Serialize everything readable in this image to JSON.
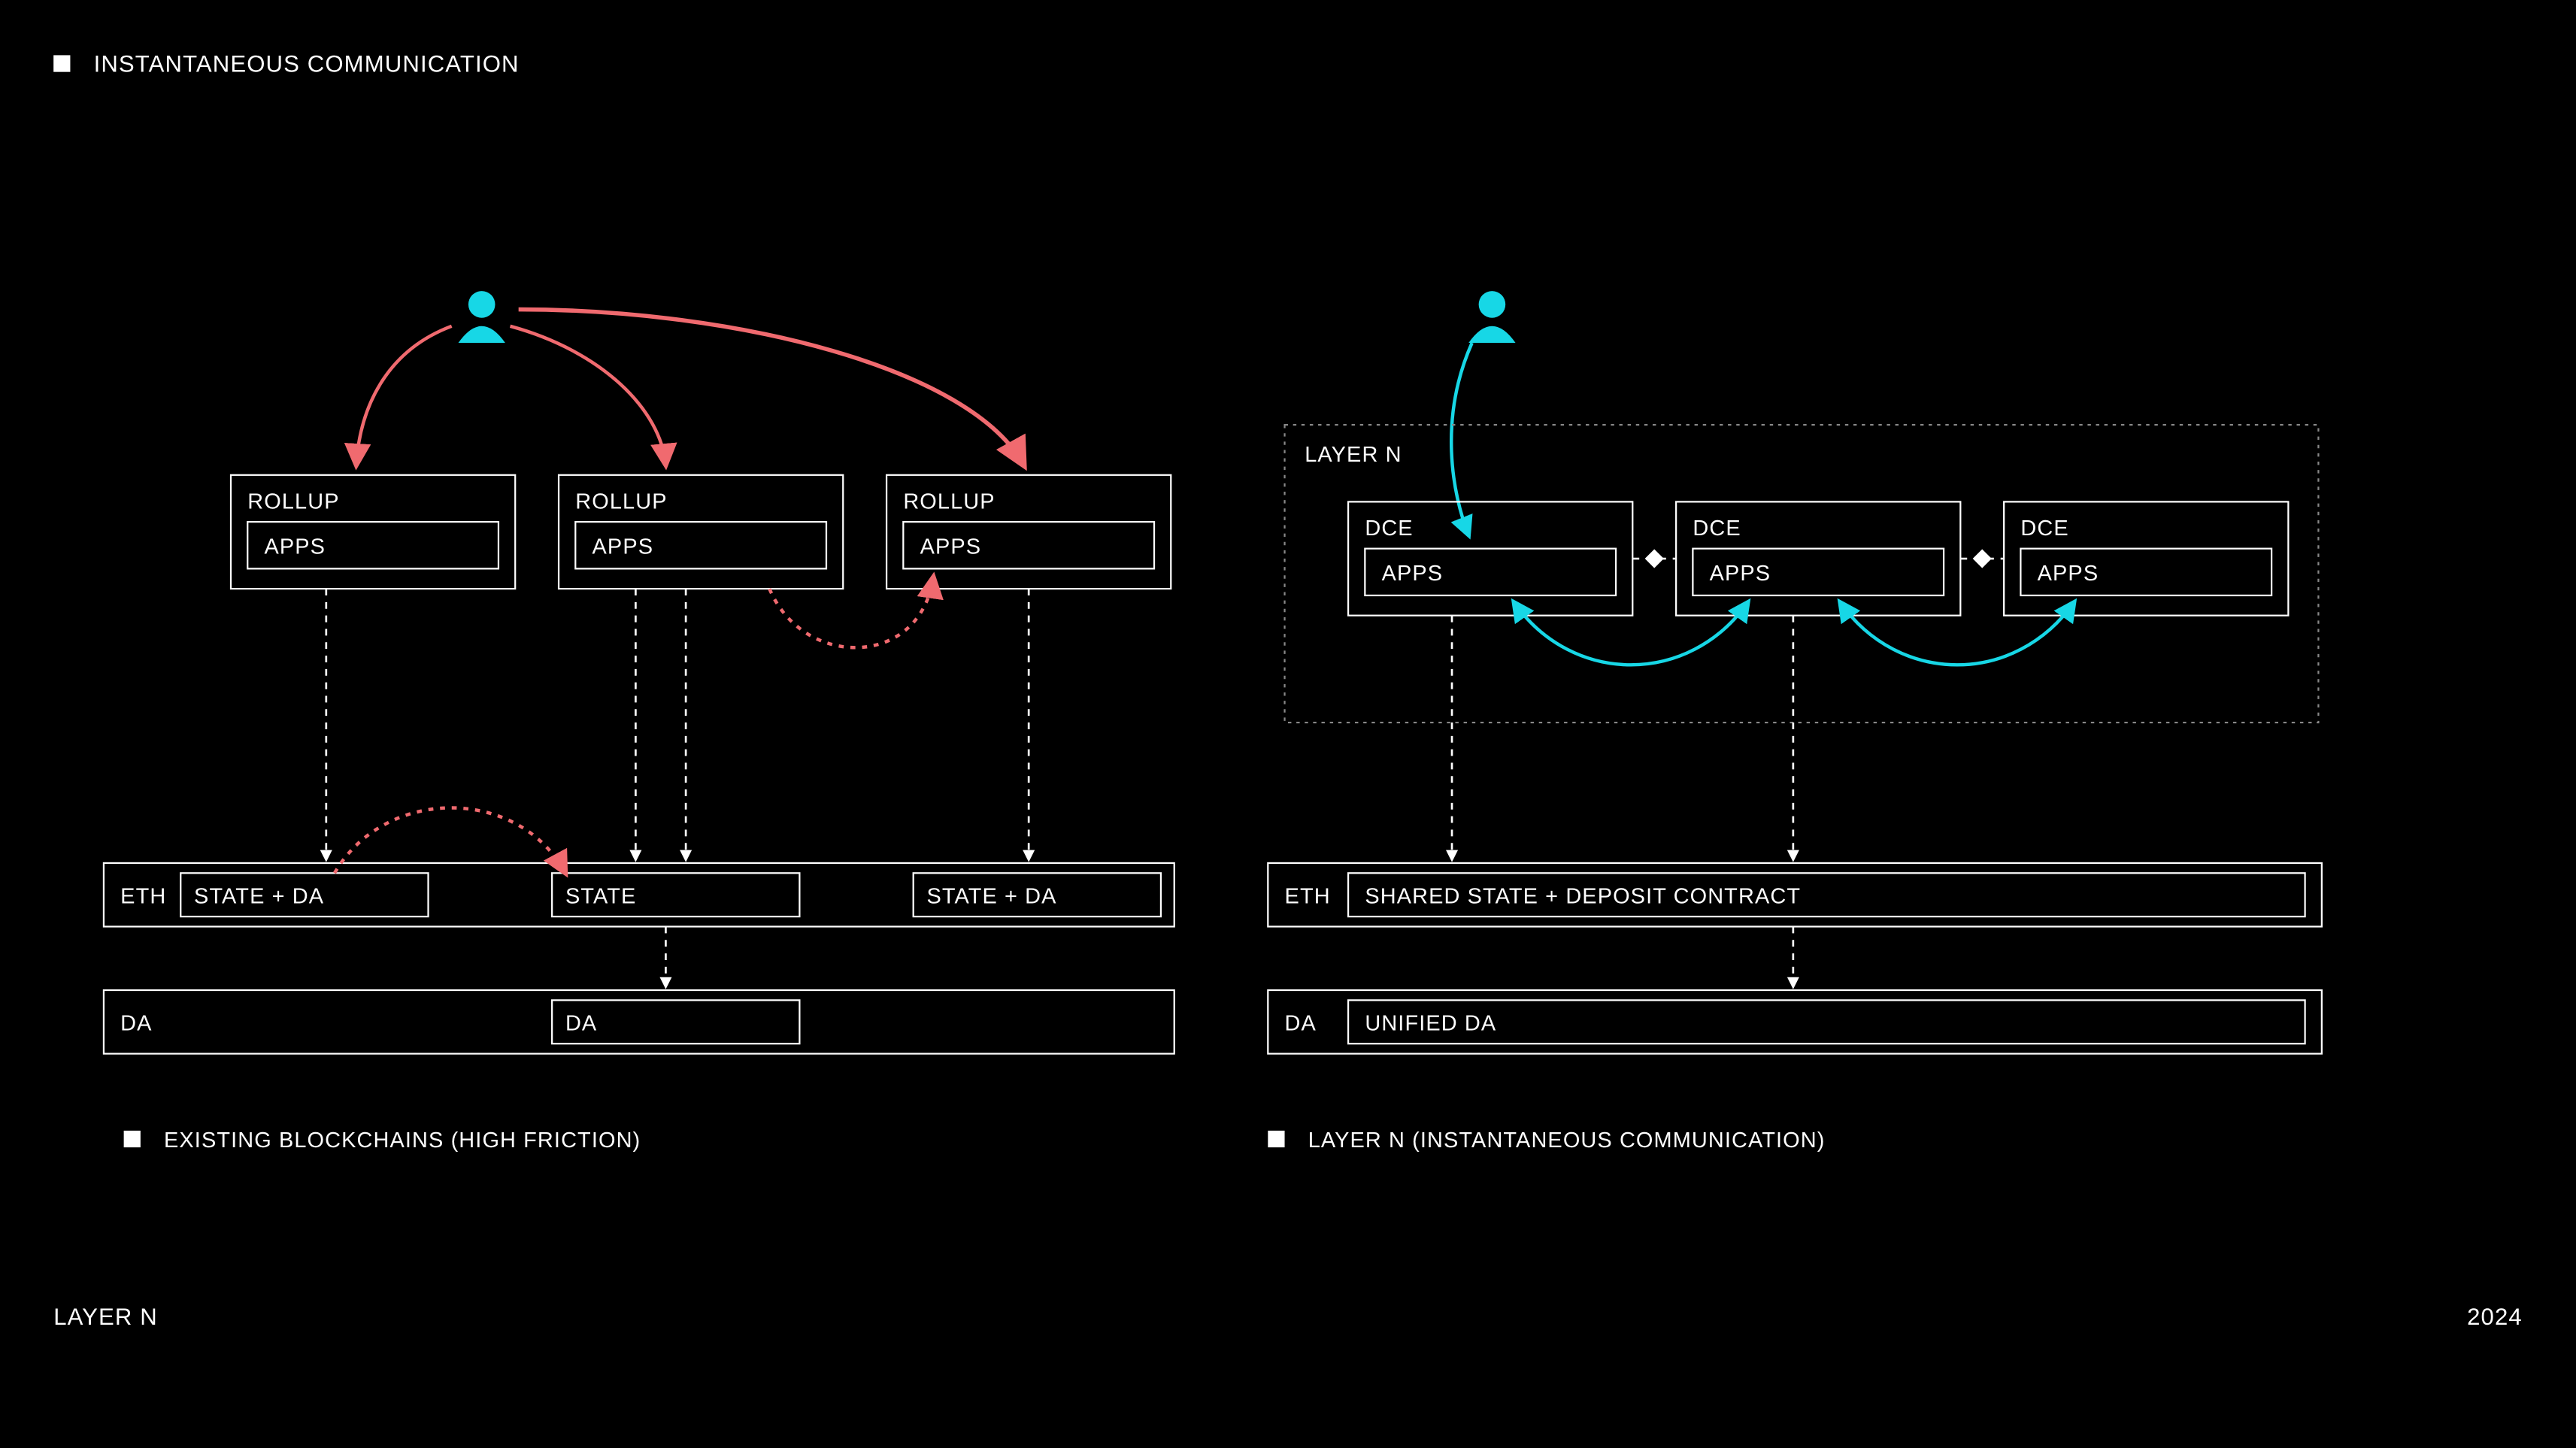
{
  "header": {
    "title": "INSTANTANEOUS COMMUNICATION"
  },
  "footer": {
    "brand": "LAYER N",
    "year": "2024"
  },
  "colors": {
    "cyan": "#17d7e6",
    "salmon": "#f06a6f",
    "white": "#ffffff",
    "black": "#000000"
  },
  "left": {
    "rollups": [
      {
        "label": "ROLLUP",
        "sub": "APPS"
      },
      {
        "label": "ROLLUP",
        "sub": "APPS"
      },
      {
        "label": "ROLLUP",
        "sub": "APPS"
      }
    ],
    "eth": {
      "label": "ETH",
      "cells": [
        "STATE + DA",
        "STATE",
        "STATE + DA"
      ]
    },
    "da": {
      "label": "DA",
      "cells": [
        "DA"
      ]
    },
    "caption": "EXISTING BLOCKCHAINS (HIGH FRICTION)"
  },
  "right": {
    "container_label": "LAYER N",
    "dce": [
      {
        "label": "DCE",
        "sub": "APPS"
      },
      {
        "label": "DCE",
        "sub": "APPS"
      },
      {
        "label": "DCE",
        "sub": "APPS"
      }
    ],
    "eth": {
      "label": "ETH",
      "cell": "SHARED STATE + DEPOSIT CONTRACT"
    },
    "da": {
      "label": "DA",
      "cell": "UNIFIED DA"
    },
    "caption": "LAYER N (INSTANTANEOUS COMMUNICATION)"
  }
}
